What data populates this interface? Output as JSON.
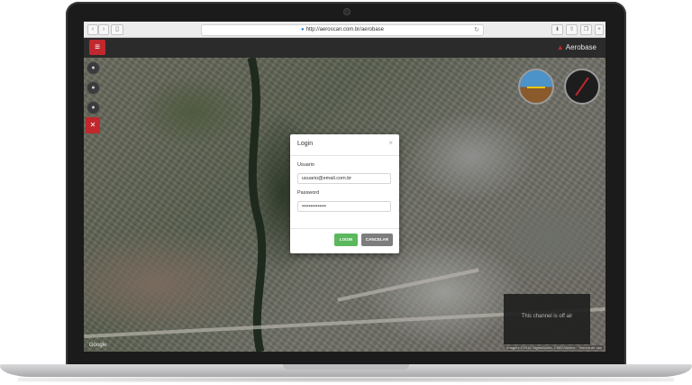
{
  "browser": {
    "url": "http://aeroscan.com.br/aerobase",
    "back_icon": "chevron-left-icon",
    "forward_icon": "chevron-right-icon"
  },
  "app": {
    "brand_name": "Aerobase",
    "menu_icon": "document-icon"
  },
  "login_modal": {
    "title": "Login",
    "close_symbol": "×",
    "username_label": "Usuario",
    "username_value": "usuario@email.com.br",
    "password_label": "Password",
    "password_value": "••••••••••••••",
    "login_button": "LOGIN",
    "cancel_button": "CANCELAR"
  },
  "camera_panel": {
    "message": "This channel is off air"
  },
  "map": {
    "logo": "Google",
    "attribution": "Imagery ©2016 DigitalGlobe, CNES/Airbus · Termos de uso"
  },
  "colors": {
    "accent": "#c0282d",
    "login_button": "#5bb85d",
    "cancel_button": "#7d7d7d"
  }
}
